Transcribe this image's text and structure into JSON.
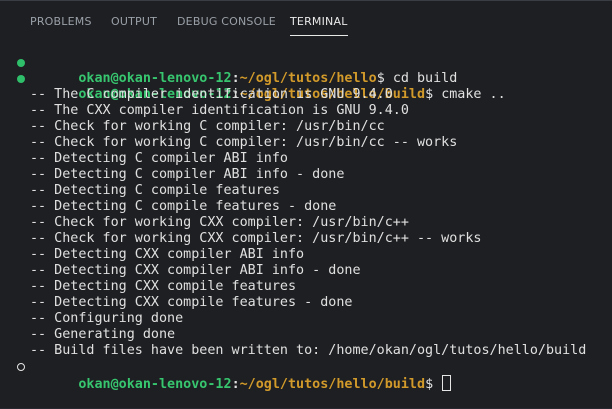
{
  "tabs": [
    {
      "label": "PROBLEMS",
      "active": false
    },
    {
      "label": "OUTPUT",
      "active": false
    },
    {
      "label": "DEBUG CONSOLE",
      "active": false
    },
    {
      "label": "TERMINAL",
      "active": true
    }
  ],
  "terminal": {
    "prompt_user": "okan@okan-lenovo-12",
    "prompts": [
      {
        "path": "~/ogl/tutos/hello",
        "command": "cd build",
        "status": "success"
      },
      {
        "path": "~/ogl/tutos/hello/build",
        "command": "cmake ..",
        "status": "success"
      },
      {
        "path": "~/ogl/tutos/hello/build",
        "command": "",
        "status": "idle"
      }
    ],
    "output": [
      "-- The C compiler identification is GNU 9.4.0",
      "-- The CXX compiler identification is GNU 9.4.0",
      "-- Check for working C compiler: /usr/bin/cc",
      "-- Check for working C compiler: /usr/bin/cc -- works",
      "-- Detecting C compiler ABI info",
      "-- Detecting C compiler ABI info - done",
      "-- Detecting C compile features",
      "-- Detecting C compile features - done",
      "-- Check for working CXX compiler: /usr/bin/c++",
      "-- Check for working CXX compiler: /usr/bin/c++ -- works",
      "-- Detecting CXX compiler ABI info",
      "-- Detecting CXX compiler ABI info - done",
      "-- Detecting CXX compile features",
      "-- Detecting CXX compile features - done",
      "-- Configuring done",
      "-- Generating done",
      "-- Build files have been written to: /home/okan/ogl/tutos/hello/build"
    ]
  },
  "colors": {
    "background": "#1e1f22",
    "prompt_user": "#37c66f",
    "prompt_path": "#d29a2a",
    "success_dot": "#2fbf6b",
    "text": "#e0e0e0"
  }
}
